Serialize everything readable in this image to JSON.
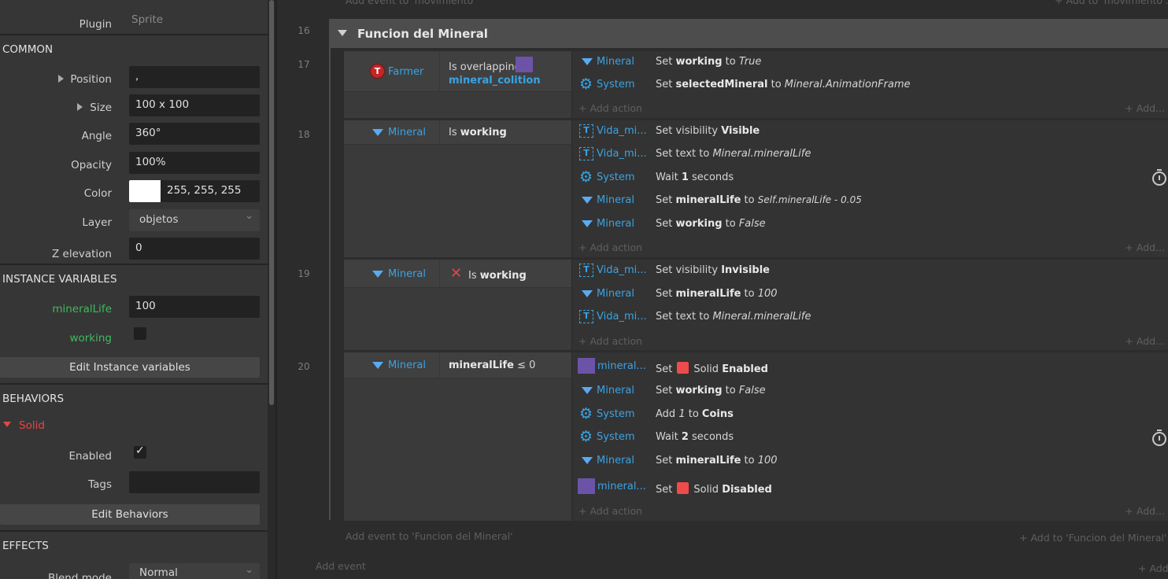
{
  "properties": {
    "plugin_label": "Plugin",
    "plugin_value": "Sprite",
    "common": {
      "title": "COMMON",
      "position_label": "Position",
      "position_value": ",",
      "size_label": "Size",
      "size_value": "100 x 100",
      "angle_label": "Angle",
      "angle_value": "360°",
      "opacity_label": "Opacity",
      "opacity_value": "100%",
      "color_label": "Color",
      "color_value": "255, 255, 255",
      "color_swatch": "#ffffff",
      "layer_label": "Layer",
      "layer_value": "objetos",
      "z_label": "Z elevation",
      "z_value": "0"
    },
    "instance_variables": {
      "title": "INSTANCE VARIABLES",
      "mineralLife_label": "mineralLife",
      "mineralLife_value": "100",
      "working_label": "working",
      "working_checked": false,
      "edit_button": "Edit Instance variables"
    },
    "behaviors": {
      "title": "BEHAVIORS",
      "solid_label": "Solid",
      "enabled_label": "Enabled",
      "enabled_checked": true,
      "tags_label": "Tags",
      "tags_value": "",
      "edit_button": "Edit Behaviors"
    },
    "effects": {
      "title": "EFFECTS",
      "blend_label": "Blend mode",
      "blend_value": "Normal"
    }
  },
  "sheet": {
    "top_add_event": "Add event to 'movimiento'",
    "top_add_to": "+ Add to 'movimiento'...",
    "group": {
      "number": "16",
      "title": "Funcion del Mineral"
    },
    "events": [
      {
        "number": "17",
        "condition": {
          "object": "Farmer",
          "text_pre": "Is overlapping",
          "target": "mineral_colition"
        },
        "actions": [
          {
            "object": "Mineral",
            "pre": "Set ",
            "b1": "working",
            "mid": " to ",
            "i1": "True"
          },
          {
            "object": "System",
            "pre": "Set ",
            "b1": "selectedMineral",
            "mid": " to ",
            "i1": "Mineral.AnimationFrame"
          }
        ]
      },
      {
        "number": "18",
        "condition": {
          "object": "Mineral",
          "text_pre": "Is ",
          "text_b": "working"
        },
        "actions": [
          {
            "object": "Vida_mi...",
            "pre": "Set visibility ",
            "b1": "Visible"
          },
          {
            "object": "Vida_mi...",
            "pre": "Set text to ",
            "i1": "Mineral.mineralLife"
          },
          {
            "object": "System",
            "pre": "Wait ",
            "b1": "1",
            "mid": " seconds"
          },
          {
            "object": "Mineral",
            "pre": "Set ",
            "b1": "mineralLife",
            "mid": " to ",
            "i1": "Self.mineralLife - 0.05"
          },
          {
            "object": "Mineral",
            "pre": "Set ",
            "b1": "working",
            "mid": " to ",
            "i1": "False"
          }
        ]
      },
      {
        "number": "19",
        "condition": {
          "object": "Mineral",
          "text_pre": "Is ",
          "text_b": "working"
        },
        "actions": [
          {
            "object": "Vida_mi...",
            "pre": "Set visibility ",
            "b1": "Invisible"
          },
          {
            "object": "Mineral",
            "pre": "Set ",
            "b1": "mineralLife",
            "mid": " to ",
            "i1": "100"
          },
          {
            "object": "Vida_mi...",
            "pre": "Set text to ",
            "i1": "Mineral.mineralLife"
          }
        ]
      },
      {
        "number": "20",
        "condition": {
          "object": "Mineral",
          "text_b": "mineralLife",
          "text_post": " ≤ 0"
        },
        "actions": [
          {
            "object": "mineral...",
            "pre": "Set",
            "mid": "Solid ",
            "b1": "Enabled"
          },
          {
            "object": "Mineral",
            "pre": "Set ",
            "b1": "working",
            "mid": " to ",
            "i1": "False"
          },
          {
            "object": "System",
            "pre": "Add ",
            "i1": "1",
            "mid": " to ",
            "b1": "Coins"
          },
          {
            "object": "System",
            "pre": "Wait ",
            "b1": "2",
            "mid": " seconds"
          },
          {
            "object": "Mineral",
            "pre": "Set ",
            "b1": "mineralLife",
            "mid": " to ",
            "i1": "100"
          },
          {
            "object": "mineral...",
            "pre": "Set",
            "mid": "Solid ",
            "b1": "Disabled"
          }
        ]
      }
    ],
    "add_action": "+ Add action",
    "add_right": "+ Add...",
    "group_add_event": "Add event to 'Funcion del Mineral'",
    "group_add_to": "+ Add to 'Funcion del Mineral'...",
    "add_event": "Add event",
    "add_bottom": "+ Add"
  },
  "colors": {
    "object_blue": "#3aa3e3",
    "variable_green": "#3dbb5c",
    "behavior_red": "#e84545",
    "sprite_purple": "#6b54a8"
  }
}
